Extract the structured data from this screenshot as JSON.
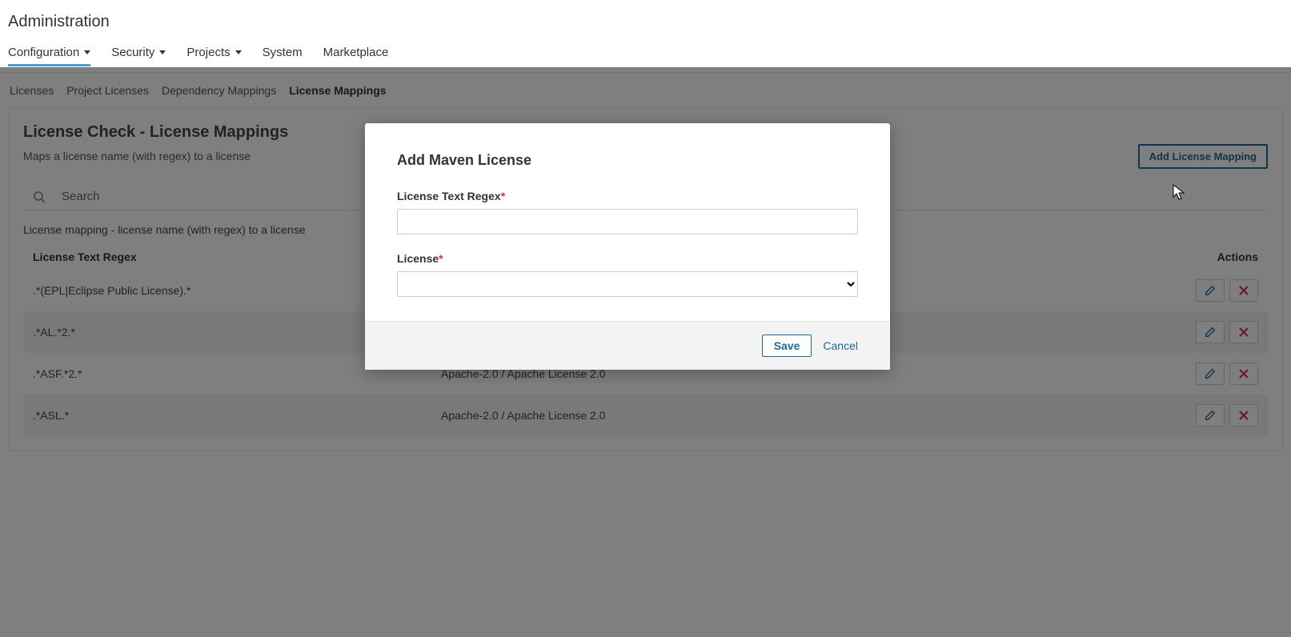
{
  "header": {
    "title": "Administration"
  },
  "topnav": {
    "items": [
      {
        "label": "Configuration",
        "hasCaret": true,
        "active": true
      },
      {
        "label": "Security",
        "hasCaret": true,
        "active": false
      },
      {
        "label": "Projects",
        "hasCaret": true,
        "active": false
      },
      {
        "label": "System",
        "hasCaret": false,
        "active": false
      },
      {
        "label": "Marketplace",
        "hasCaret": false,
        "active": false
      }
    ]
  },
  "subnav": {
    "items": [
      {
        "label": "Licenses",
        "active": false
      },
      {
        "label": "Project Licenses",
        "active": false
      },
      {
        "label": "Dependency Mappings",
        "active": false
      },
      {
        "label": "License Mappings",
        "active": true
      }
    ]
  },
  "panel": {
    "title": "License Check - License Mappings",
    "subtitle": "Maps a license name (with regex) to a license",
    "add_button": "Add License Mapping",
    "search_placeholder": "Search",
    "table_caption": "License mapping - license name (with regex) to a license",
    "columns": {
      "regex": "License Text Regex",
      "license": "",
      "actions": "Actions"
    },
    "rows": [
      {
        "regex": ".*(EPL|Eclipse Public License).*",
        "license": ""
      },
      {
        "regex": ".*AL.*2.*",
        "license": ""
      },
      {
        "regex": ".*ASF.*2.*",
        "license": "Apache-2.0 / Apache License 2.0"
      },
      {
        "regex": ".*ASL.*",
        "license": "Apache-2.0 / Apache License 2.0"
      }
    ]
  },
  "modal": {
    "title": "Add Maven License",
    "field_regex_label": "License Text Regex",
    "field_license_label": "License",
    "save": "Save",
    "cancel": "Cancel"
  },
  "colors": {
    "link": "#236a97",
    "danger": "#d4333f"
  }
}
